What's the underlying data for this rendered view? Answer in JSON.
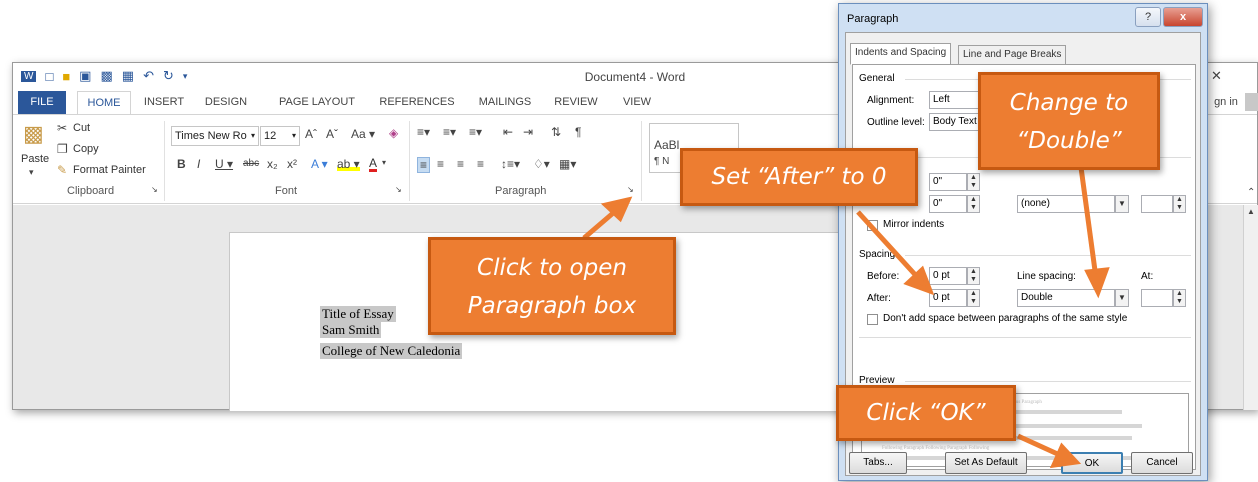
{
  "word": {
    "title": "Document4 - Word",
    "sign_in": "gn in",
    "qat_icons": [
      "word-icon",
      "new-doc-icon",
      "open-icon",
      "save-icon",
      "save-as-icon",
      "print-preview-icon",
      "undo-icon",
      "redo-icon",
      "customize-icon"
    ],
    "tabs": [
      "FILE",
      "HOME",
      "INSERT",
      "DESIGN",
      "PAGE LAYOUT",
      "REFERENCES",
      "MAILINGS",
      "REVIEW",
      "VIEW"
    ],
    "ribbon": {
      "paste": "Paste",
      "cut": "Cut",
      "copy": "Copy",
      "format_painter": "Format Painter",
      "font_name": "Times New Ro",
      "font_size": "12",
      "font_group": "Font",
      "clipboard_group": "Clipboard",
      "paragraph_group": "Paragraph",
      "styles_preview": "AaBl",
      "styles_sub": "¶ N",
      "case_btn": "Aa"
    },
    "document": {
      "line1": "Title of Essay",
      "line2": "Sam Smith",
      "line3": "College of New Caledonia"
    }
  },
  "dialog": {
    "title": "Paragraph",
    "help": "?",
    "close": "x",
    "tabs": [
      "Indents and Spacing",
      "Line and Page Breaks"
    ],
    "general": {
      "section": "General",
      "alignment_label": "Alignment:",
      "alignment_value": "Left",
      "outline_label": "Outline level:",
      "outline_value": "Body Text"
    },
    "indentation": {
      "left_value": "0\"",
      "right_value": "0\"",
      "special_value": "(none)",
      "mirror": "Mirror indents"
    },
    "spacing": {
      "section": "Spacing",
      "before_label": "Before:",
      "before_value": "0 pt",
      "after_label": "After:",
      "after_value": "0 pt",
      "line_spacing_label": "Line spacing:",
      "line_spacing_value": "Double",
      "at_label": "At:",
      "dont_add": "Don't add space between paragraphs of the same style"
    },
    "preview": {
      "section": "Preview",
      "text_prev": "Previous Paragraph Previous Paragraph Previous Paragraph Previous Paragraph",
      "text_follow": "Following Paragraph Following Paragraph Following"
    },
    "buttons": {
      "tabs": "Tabs...",
      "default": "Set As Default",
      "ok": "OK",
      "cancel": "Cancel"
    }
  },
  "callouts": {
    "open_box": [
      "Click to open",
      "Paragraph box"
    ],
    "after": "Set “After” to 0",
    "double": [
      "Change to",
      "“Double”"
    ],
    "ok": "Click “OK”"
  },
  "colors": {
    "accent": "#2b579a",
    "callout": "#ed7d31",
    "callout_border": "#c65911"
  }
}
